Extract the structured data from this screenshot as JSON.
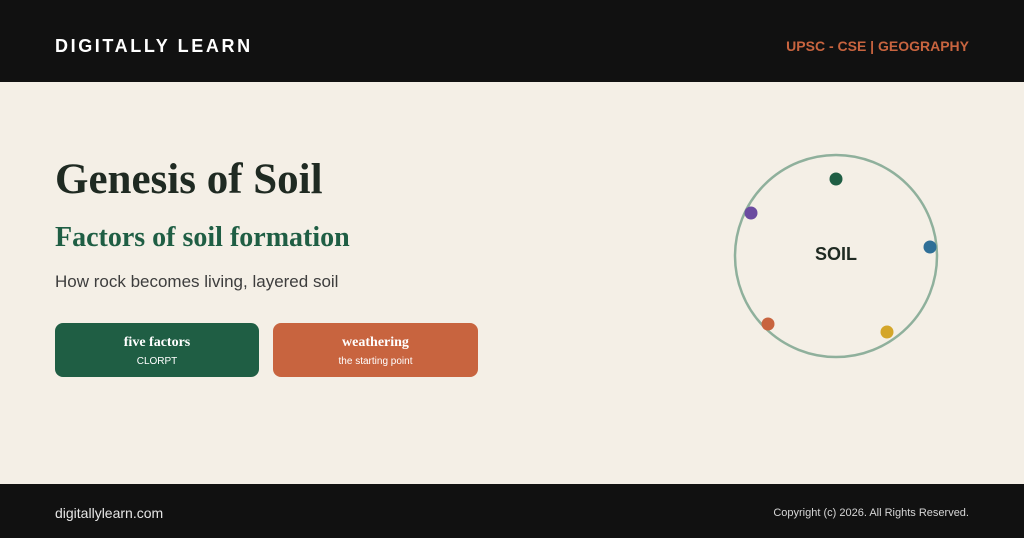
{
  "header": {
    "brand": "DIGITALLY LEARN",
    "tag": "UPSC - CSE | GEOGRAPHY"
  },
  "hero": {
    "title": "Genesis of Soil",
    "subtitle": "Factors of soil formation",
    "description": "How rock becomes living, layered soil"
  },
  "cards": [
    {
      "title": "five factors",
      "subtitle": "CLORPT",
      "color": "#1f5e44"
    },
    {
      "title": "weathering",
      "subtitle": "the starting point",
      "color": "#c8643f"
    }
  ],
  "diagram": {
    "center_label": "SOIL",
    "ring_color": "#8fb09c",
    "dot_colors": [
      "#1f5e44",
      "#2f6f97",
      "#d4a62a",
      "#c8643f",
      "#6b4ba0"
    ]
  },
  "footer": {
    "site": "digitallylearn.com",
    "copyright": "Copyright (c) 2026. All Rights Reserved."
  },
  "colors": {
    "bar_background": "#111111",
    "page_background": "#f4efe6",
    "accent_orange": "#c8643f",
    "accent_green": "#1f5e44"
  }
}
